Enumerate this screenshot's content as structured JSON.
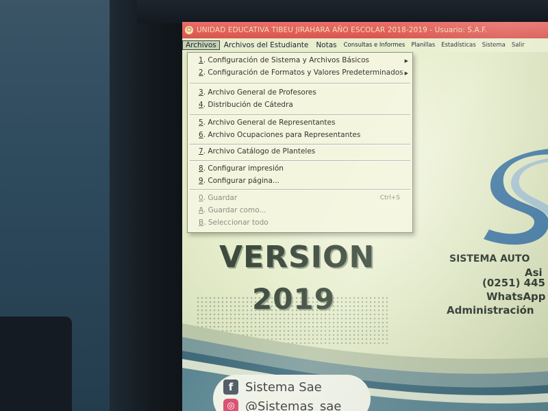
{
  "window": {
    "title": "UNIDAD EDUCATIVA TIBEU JIRAHARA AÑO ESCOLAR 2018-2019 - Usuario: S.A.F."
  },
  "menubar": {
    "items": [
      {
        "label": "Archivos",
        "active": true
      },
      {
        "label": "Archivos del Estudiante"
      },
      {
        "label": "Notas"
      },
      {
        "label": "Consultas e Informes"
      },
      {
        "label": "Planillas"
      },
      {
        "label": "Estadísticas"
      },
      {
        "label": "Sistema"
      },
      {
        "label": "Salir"
      }
    ]
  },
  "dropdown": {
    "items": [
      {
        "key": "1",
        "label": ". Configuración de Sistema y Archivos Básicos",
        "submenu": true
      },
      {
        "key": "2",
        "label": ". Configuración de Formatos y Valores Predeterminados",
        "submenu": true
      },
      {
        "key": "3",
        "label": ". Archivo General de Profesores"
      },
      {
        "key": "4",
        "label": ". Distribución de Cátedra"
      },
      {
        "key": "5",
        "label": ". Archivo General de Representantes"
      },
      {
        "key": "6",
        "label": ". Archivo Ocupaciones para Representantes"
      },
      {
        "key": "7",
        "label": ". Archivo Catálogo de Planteles"
      },
      {
        "key": "8",
        "label": ". Configurar impresión"
      },
      {
        "key": "9",
        "label": ". Configurar página..."
      },
      {
        "key": "0",
        "label": ". Guardar",
        "shortcut": "Ctrl+S",
        "disabled": true
      },
      {
        "key": "A",
        "label": ". Guardar como...",
        "disabled": true
      },
      {
        "key": "B",
        "label": ". Seleccionar todo",
        "disabled": true
      }
    ]
  },
  "splash": {
    "version_word": "VERSION",
    "version_year": "2019",
    "brand_name": "SISTEMA AUTO",
    "brand_line2": "Asi",
    "phone": "(0251) 445",
    "whatsapp": "WhatsApp",
    "admin": "Administración",
    "facebook_handle": "Sistema Sae",
    "instagram_handle": "@Sistemas_sae"
  },
  "colors": {
    "titlebar": "#d9554f",
    "menubar": "#e8efcf",
    "dropdown_bg": "#f3f5de",
    "logo_blue": "#4a7fa8"
  }
}
